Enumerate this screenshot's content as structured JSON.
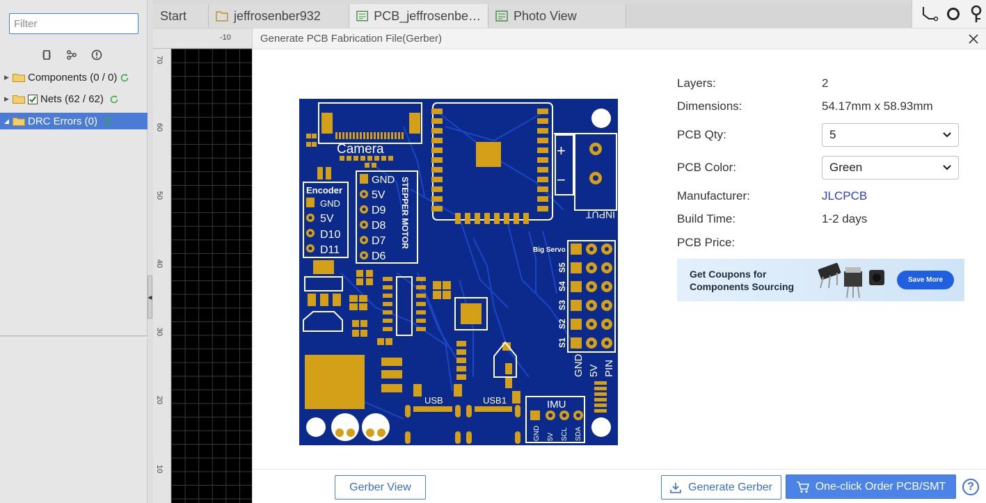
{
  "filter": {
    "placeholder": "Filter"
  },
  "tree": [
    {
      "label": "Components (0 / 0)"
    },
    {
      "label": "Nets (62 / 62)"
    },
    {
      "label": "DRC Errors (0)"
    }
  ],
  "tabs": [
    {
      "label": "Start"
    },
    {
      "label": "jeffrosenber932"
    },
    {
      "label": "PCB_jeffrosenbe…"
    },
    {
      "label": "Photo View"
    }
  ],
  "rulers": {
    "top": [
      "-10"
    ],
    "left": [
      "70",
      "60",
      "50",
      "40",
      "30",
      "20",
      "10"
    ]
  },
  "modal": {
    "title": "Generate PCB Fabrication File(Gerber)",
    "layers_label": "Layers:",
    "layers_value": "2",
    "dimensions_label": "Dimensions:",
    "dimensions_value": "54.17mm x 58.93mm",
    "qty_label": "PCB Qty:",
    "qty_value": "5",
    "color_label": "PCB Color:",
    "color_value": "Green",
    "manufacturer_label": "Manufacturer:",
    "manufacturer_value": "JLCPCB",
    "build_label": "Build Time:",
    "build_value": "1-2 days",
    "price_label": "PCB Price:",
    "banner_text": "Get Coupons for Components Sourcing",
    "banner_button": "Save More",
    "gerber_view": "Gerber View",
    "generate_gerber": "Generate Gerber",
    "order": "One-click Order PCB/SMT",
    "help": "?"
  },
  "pcb": {
    "silk": {
      "camera": "Camera",
      "encoder": "Encoder",
      "enc_pins": [
        "GND",
        "5V",
        "D10",
        "D11"
      ],
      "stepper_pins": [
        "GND",
        "5V",
        "D9",
        "D8",
        "D7",
        "D6"
      ],
      "stepper_label": "STEPPER MOTOR",
      "input": "INPUT",
      "big_servo": "Big Servo",
      "servo_labels": [
        "S5",
        "S4",
        "S3",
        "S2",
        "S1"
      ],
      "servo_bottom": [
        "GND",
        "5V",
        "PIN"
      ],
      "usb": "USB",
      "usb1": "USB1",
      "imu": "IMU",
      "imu_pins": [
        "GND",
        "5V",
        "SCL",
        "SDA"
      ],
      "plus": "+",
      "minus": "−"
    }
  },
  "colors": {
    "pcb_board": "#0a2a8a",
    "pcb_pad": "#d4a017",
    "accent": "#4b84e6",
    "link": "#2b3fbf"
  }
}
